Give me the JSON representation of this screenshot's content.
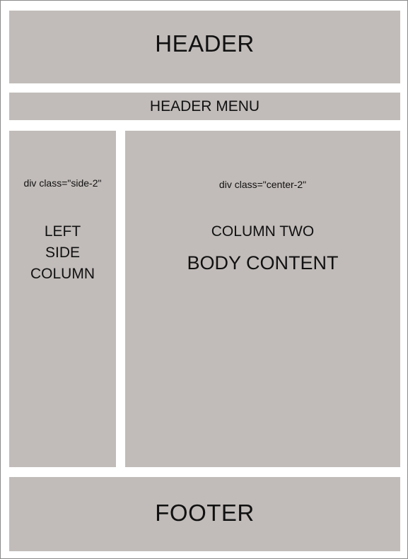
{
  "header": {
    "label": "HEADER"
  },
  "header_menu": {
    "label": "HEADER MENU"
  },
  "side_column": {
    "class_label": "div class=\"side-2\"",
    "title_lines": [
      "LEFT",
      "SIDE",
      "COLUMN"
    ]
  },
  "center_column": {
    "class_label": "div class=\"center-2\"",
    "title": "COLUMN TWO",
    "subtitle": "BODY CONTENT"
  },
  "footer": {
    "label": "FOOTER"
  },
  "colors": {
    "block_fill": "#c1bcb9",
    "background": "#ffffff",
    "border": "#8a8a8a"
  }
}
